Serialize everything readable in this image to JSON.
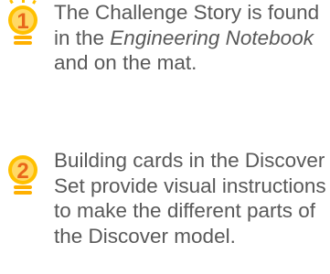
{
  "colors": {
    "bulb_fill": "#ffc000",
    "bulb_light": "#ffd966",
    "number_color": "#e8661a",
    "text_color": "#595959",
    "base_color": "#ffb000"
  },
  "callouts": [
    {
      "number": "1",
      "icon": "lightbulb-icon",
      "text_before": "The Challenge Story is found in the ",
      "text_italic": "Engineering Notebook",
      "text_after": " and on the mat."
    },
    {
      "number": "2",
      "icon": "lightbulb-icon",
      "text": "Building cards in the Discover Set provide visual instructions to make the different parts of the Discover model."
    }
  ]
}
